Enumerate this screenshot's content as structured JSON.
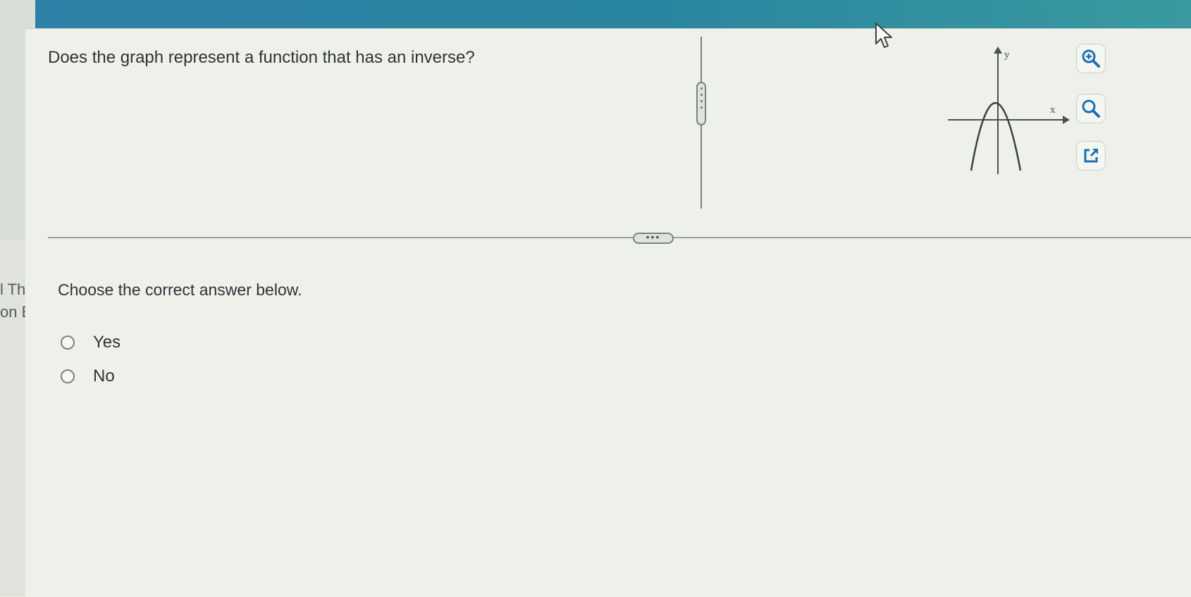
{
  "question": "Does the graph represent a function that has an inverse?",
  "graph": {
    "x_label": "x",
    "y_label": "y",
    "curve": "downward-opening parabola"
  },
  "toolbar": {
    "zoom_in_icon": "zoom-in-icon",
    "zoom_out_icon": "zoom-out-icon",
    "popout_icon": "external-link-icon"
  },
  "prompt": "Choose the correct answer below.",
  "options": [
    {
      "label": "Yes",
      "selected": false
    },
    {
      "label": "No",
      "selected": false
    }
  ],
  "sidebar": {
    "fragment_1": "l Thu",
    "fragment_2": "on Ec"
  },
  "splitter_handle": "•••",
  "colors": {
    "accent_bar": "#2f7fa6",
    "icon_blue": "#1f6fb0"
  }
}
